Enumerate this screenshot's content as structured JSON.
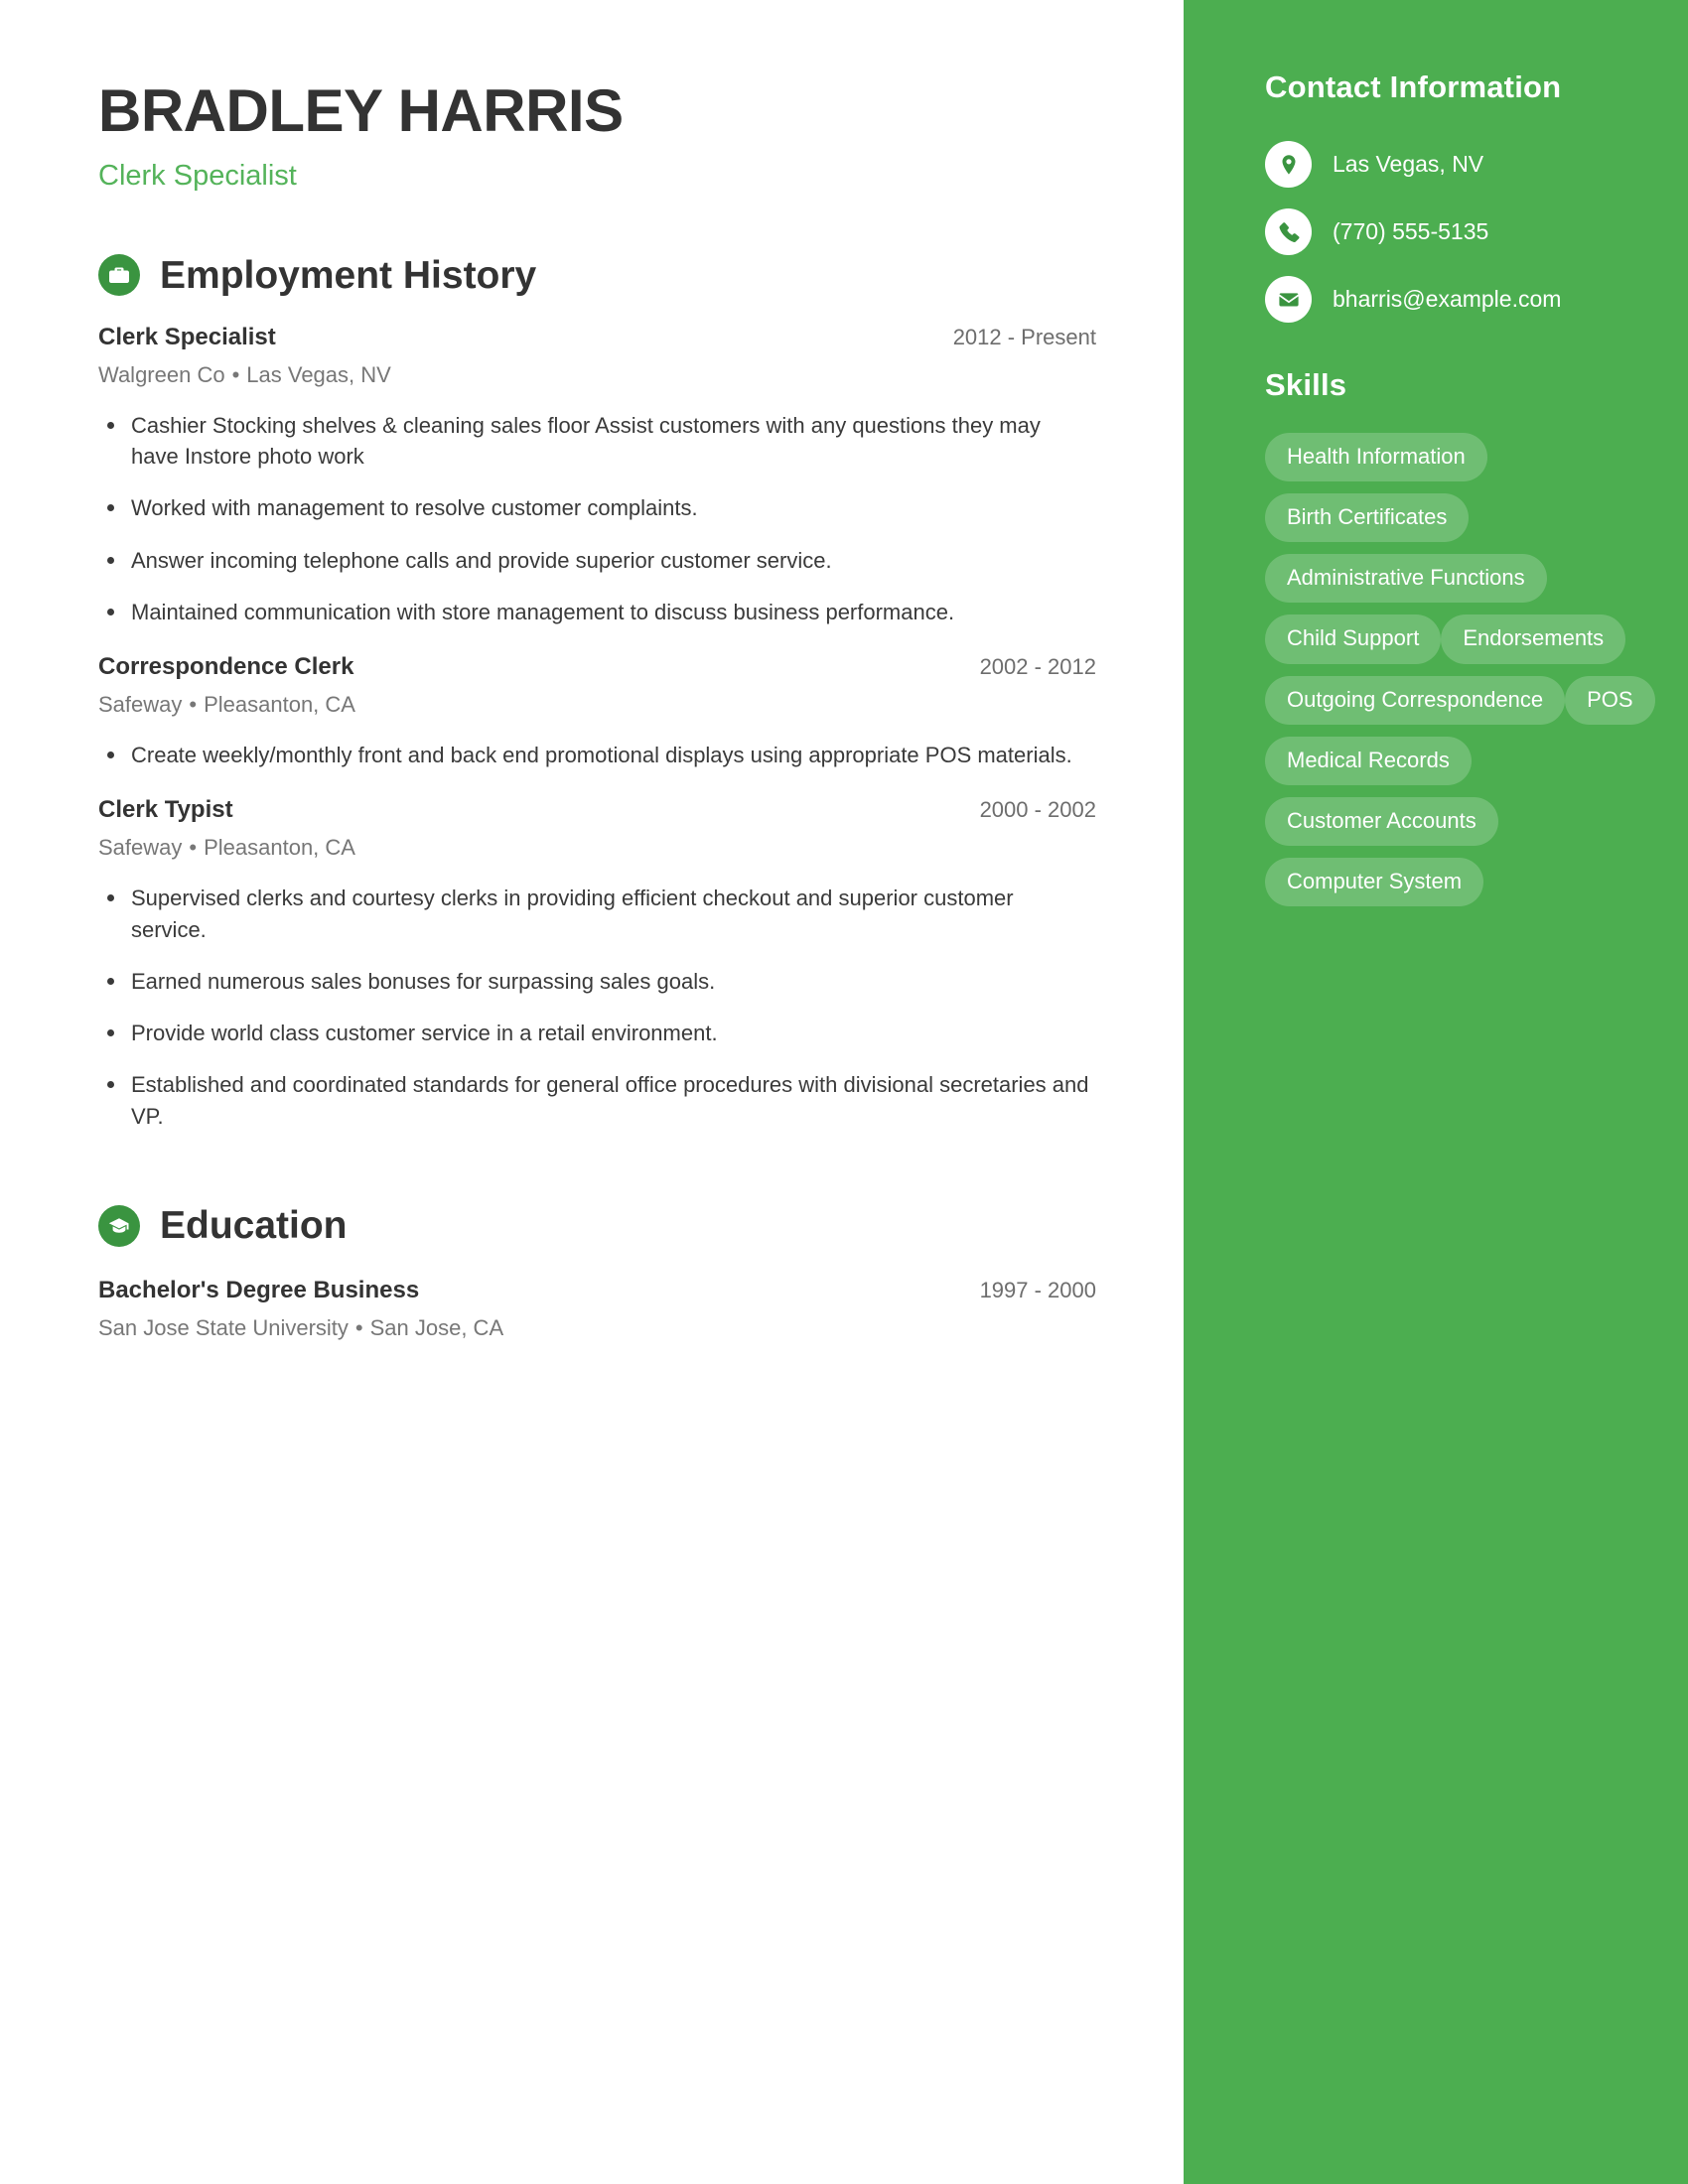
{
  "header": {
    "name": "BRADLEY HARRIS",
    "title": "Clerk Specialist"
  },
  "sections": {
    "employment": {
      "heading": "Employment History",
      "icon": "briefcase-icon"
    },
    "education": {
      "heading": "Education",
      "icon": "graduation-cap-icon"
    }
  },
  "employment_entries": [
    {
      "title": "Clerk Specialist",
      "dates": "2012 - Present",
      "company": "Walgreen Co",
      "location": "Las Vegas, NV",
      "bullets": [
        "Cashier Stocking shelves & cleaning sales floor Assist customers with any questions they may have Instore photo work",
        "Worked with management to resolve customer complaints.",
        "Answer incoming telephone calls and provide superior customer service.",
        "Maintained communication with store management to discuss business performance."
      ]
    },
    {
      "title": "Correspondence Clerk",
      "dates": "2002 - 2012",
      "company": "Safeway",
      "location": "Pleasanton, CA",
      "bullets": [
        "Create weekly/monthly front and back end promotional displays using appropriate POS materials."
      ]
    },
    {
      "title": "Clerk Typist",
      "dates": "2000 - 2002",
      "company": "Safeway",
      "location": "Pleasanton, CA",
      "bullets": [
        "Supervised clerks and courtesy clerks in providing efficient checkout and superior customer service.",
        "Earned numerous sales bonuses for surpassing sales goals.",
        "Provide world class customer service in a retail environment.",
        "Established and coordinated standards for general office procedures with divisional secretaries and VP."
      ]
    }
  ],
  "education_entries": [
    {
      "title": "Bachelor's Degree Business",
      "dates": "1997 - 2000",
      "school": "San Jose State University",
      "location": "San Jose, CA"
    }
  ],
  "sidebar": {
    "contact_heading": "Contact Information",
    "contact_items": [
      {
        "icon": "map-pin-icon",
        "value": "Las Vegas, NV"
      },
      {
        "icon": "phone-icon",
        "value": "(770) 555-5135"
      },
      {
        "icon": "envelope-icon",
        "value": "bharris@example.com"
      }
    ],
    "skills_heading": "Skills",
    "skills": [
      "Health Information",
      "Birth Certificates",
      "Administrative Functions",
      "Child Support",
      "Endorsements",
      "Outgoing Correspondence",
      "POS",
      "Medical Records",
      "Customer Accounts",
      "Computer System"
    ]
  },
  "separator": "•",
  "colors": {
    "sidebar_green": "#4cae50",
    "accent_green": "#54b35a",
    "icon_green": "#3a9440",
    "heading_dark": "#333333",
    "body_text": "#3a3a3a",
    "muted_text": "#777777"
  }
}
